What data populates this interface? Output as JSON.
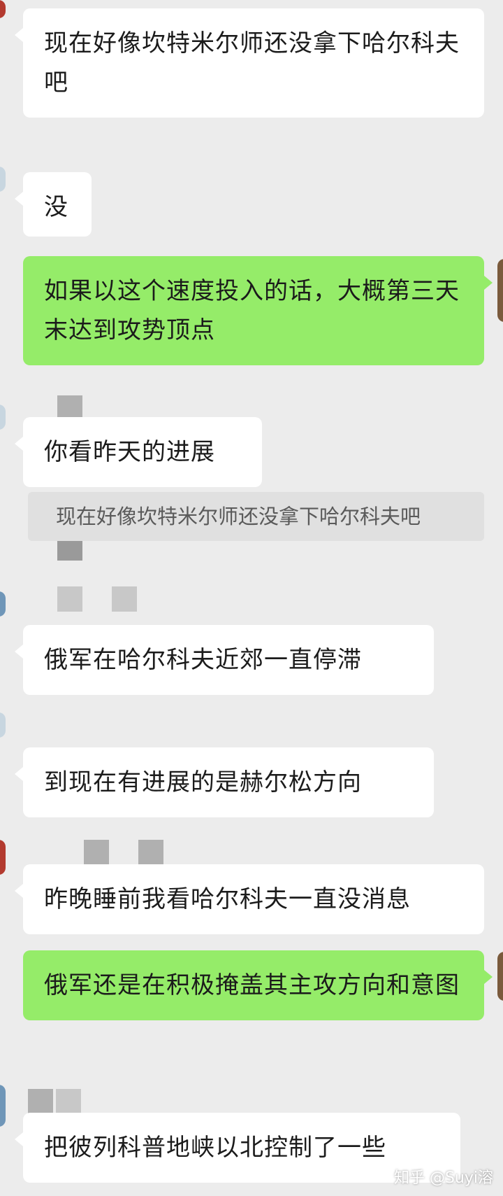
{
  "messages": [
    {
      "side": "in",
      "text": "现在好像坎特米尔师还没拿下哈尔科夫吧"
    },
    {
      "side": "in",
      "text": "没"
    },
    {
      "side": "out",
      "text": "如果以这个速度投入的话，大概第三天末达到攻势顶点"
    },
    {
      "side": "in",
      "text": "你看昨天的进展"
    },
    {
      "side": "quote",
      "text": "现在好像坎特米尔师还没拿下哈尔科夫吧"
    },
    {
      "side": "in",
      "text": "俄军在哈尔科夫近郊一直停滞"
    },
    {
      "side": "in",
      "text": "到现在有进展的是赫尔松方向"
    },
    {
      "side": "in",
      "text": "昨晚睡前我看哈尔科夫一直没消息"
    },
    {
      "side": "out",
      "text": "俄军还是在积极掩盖其主攻方向和意图"
    },
    {
      "side": "in",
      "text": "把彼列科普地峡以北控制了一些"
    }
  ],
  "watermark": "知乎 @Suyi溶",
  "colors": {
    "background": "#ececec",
    "incoming_bubble": "#ffffff",
    "outgoing_bubble": "#95ec69",
    "quote_background": "#e0e0e0"
  }
}
